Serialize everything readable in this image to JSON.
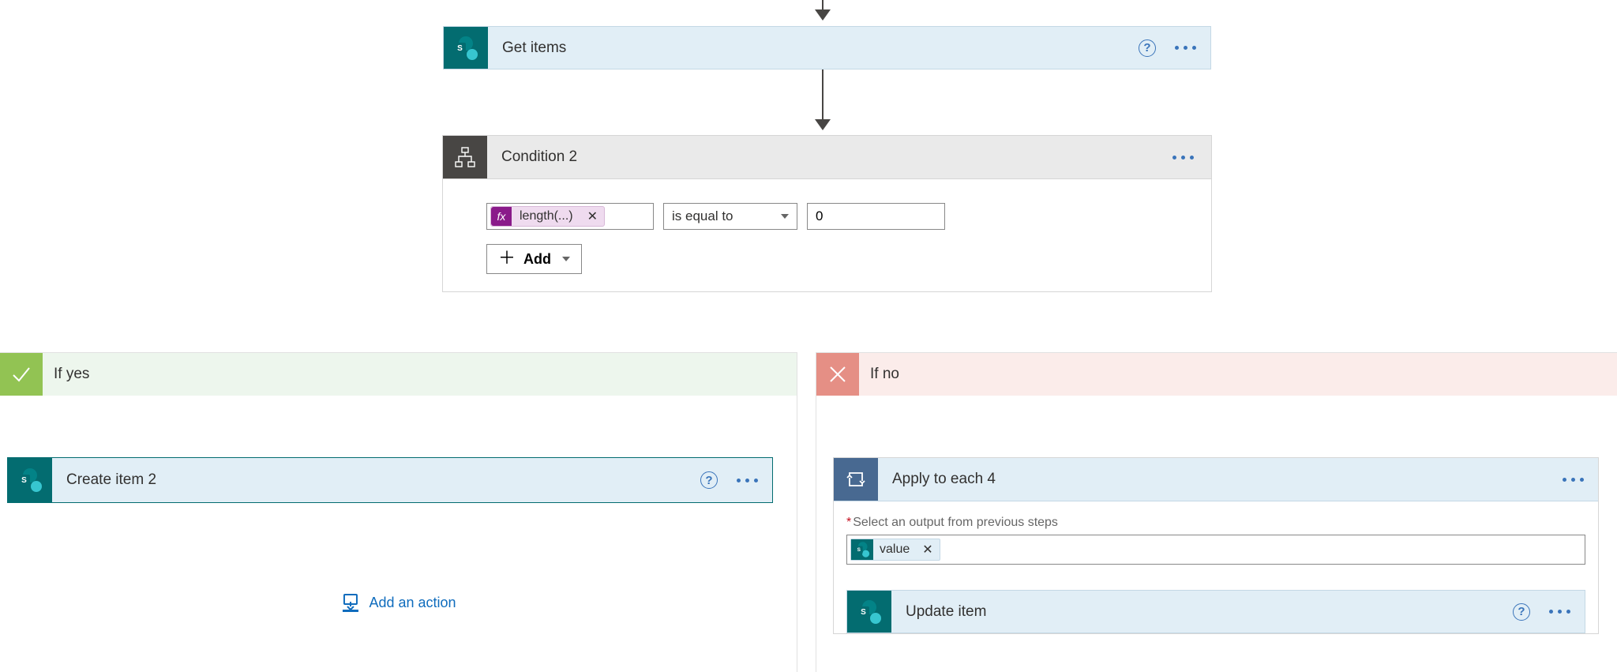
{
  "top_action": {
    "title": "Get items"
  },
  "condition": {
    "title": "Condition 2",
    "expression": "length(...)",
    "operator": "is equal to",
    "value": "0",
    "add_label": "Add"
  },
  "branch_yes": {
    "label": "If yes",
    "action": {
      "title": "Create item 2"
    },
    "add_action_label": "Add an action"
  },
  "branch_no": {
    "label": "If no",
    "apply": {
      "title": "Apply to each 4",
      "field_label": "Select an output from previous steps",
      "token": "value",
      "inner_action": {
        "title": "Update item"
      }
    }
  }
}
